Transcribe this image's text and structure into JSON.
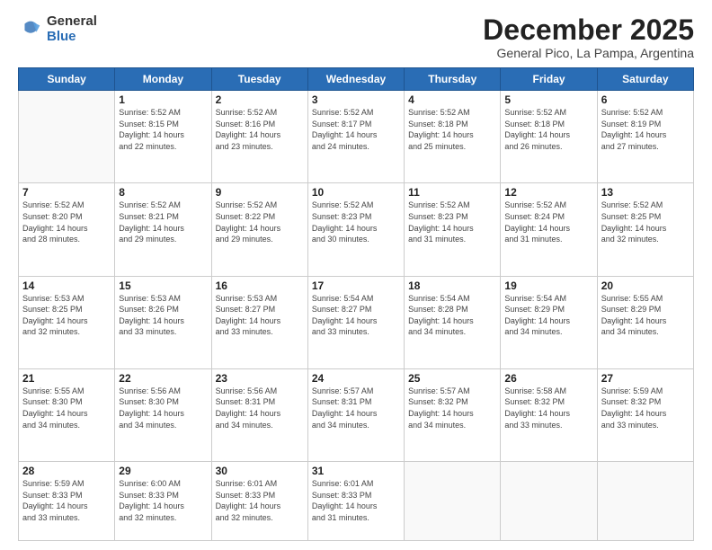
{
  "logo": {
    "general": "General",
    "blue": "Blue"
  },
  "header": {
    "month": "December 2025",
    "location": "General Pico, La Pampa, Argentina"
  },
  "days_of_week": [
    "Sunday",
    "Monday",
    "Tuesday",
    "Wednesday",
    "Thursday",
    "Friday",
    "Saturday"
  ],
  "weeks": [
    [
      {
        "day": "",
        "info": ""
      },
      {
        "day": "1",
        "info": "Sunrise: 5:52 AM\nSunset: 8:15 PM\nDaylight: 14 hours\nand 22 minutes."
      },
      {
        "day": "2",
        "info": "Sunrise: 5:52 AM\nSunset: 8:16 PM\nDaylight: 14 hours\nand 23 minutes."
      },
      {
        "day": "3",
        "info": "Sunrise: 5:52 AM\nSunset: 8:17 PM\nDaylight: 14 hours\nand 24 minutes."
      },
      {
        "day": "4",
        "info": "Sunrise: 5:52 AM\nSunset: 8:18 PM\nDaylight: 14 hours\nand 25 minutes."
      },
      {
        "day": "5",
        "info": "Sunrise: 5:52 AM\nSunset: 8:18 PM\nDaylight: 14 hours\nand 26 minutes."
      },
      {
        "day": "6",
        "info": "Sunrise: 5:52 AM\nSunset: 8:19 PM\nDaylight: 14 hours\nand 27 minutes."
      }
    ],
    [
      {
        "day": "7",
        "info": "Sunrise: 5:52 AM\nSunset: 8:20 PM\nDaylight: 14 hours\nand 28 minutes."
      },
      {
        "day": "8",
        "info": "Sunrise: 5:52 AM\nSunset: 8:21 PM\nDaylight: 14 hours\nand 29 minutes."
      },
      {
        "day": "9",
        "info": "Sunrise: 5:52 AM\nSunset: 8:22 PM\nDaylight: 14 hours\nand 29 minutes."
      },
      {
        "day": "10",
        "info": "Sunrise: 5:52 AM\nSunset: 8:23 PM\nDaylight: 14 hours\nand 30 minutes."
      },
      {
        "day": "11",
        "info": "Sunrise: 5:52 AM\nSunset: 8:23 PM\nDaylight: 14 hours\nand 31 minutes."
      },
      {
        "day": "12",
        "info": "Sunrise: 5:52 AM\nSunset: 8:24 PM\nDaylight: 14 hours\nand 31 minutes."
      },
      {
        "day": "13",
        "info": "Sunrise: 5:52 AM\nSunset: 8:25 PM\nDaylight: 14 hours\nand 32 minutes."
      }
    ],
    [
      {
        "day": "14",
        "info": "Sunrise: 5:53 AM\nSunset: 8:25 PM\nDaylight: 14 hours\nand 32 minutes."
      },
      {
        "day": "15",
        "info": "Sunrise: 5:53 AM\nSunset: 8:26 PM\nDaylight: 14 hours\nand 33 minutes."
      },
      {
        "day": "16",
        "info": "Sunrise: 5:53 AM\nSunset: 8:27 PM\nDaylight: 14 hours\nand 33 minutes."
      },
      {
        "day": "17",
        "info": "Sunrise: 5:54 AM\nSunset: 8:27 PM\nDaylight: 14 hours\nand 33 minutes."
      },
      {
        "day": "18",
        "info": "Sunrise: 5:54 AM\nSunset: 8:28 PM\nDaylight: 14 hours\nand 34 minutes."
      },
      {
        "day": "19",
        "info": "Sunrise: 5:54 AM\nSunset: 8:29 PM\nDaylight: 14 hours\nand 34 minutes."
      },
      {
        "day": "20",
        "info": "Sunrise: 5:55 AM\nSunset: 8:29 PM\nDaylight: 14 hours\nand 34 minutes."
      }
    ],
    [
      {
        "day": "21",
        "info": "Sunrise: 5:55 AM\nSunset: 8:30 PM\nDaylight: 14 hours\nand 34 minutes."
      },
      {
        "day": "22",
        "info": "Sunrise: 5:56 AM\nSunset: 8:30 PM\nDaylight: 14 hours\nand 34 minutes."
      },
      {
        "day": "23",
        "info": "Sunrise: 5:56 AM\nSunset: 8:31 PM\nDaylight: 14 hours\nand 34 minutes."
      },
      {
        "day": "24",
        "info": "Sunrise: 5:57 AM\nSunset: 8:31 PM\nDaylight: 14 hours\nand 34 minutes."
      },
      {
        "day": "25",
        "info": "Sunrise: 5:57 AM\nSunset: 8:32 PM\nDaylight: 14 hours\nand 34 minutes."
      },
      {
        "day": "26",
        "info": "Sunrise: 5:58 AM\nSunset: 8:32 PM\nDaylight: 14 hours\nand 33 minutes."
      },
      {
        "day": "27",
        "info": "Sunrise: 5:59 AM\nSunset: 8:32 PM\nDaylight: 14 hours\nand 33 minutes."
      }
    ],
    [
      {
        "day": "28",
        "info": "Sunrise: 5:59 AM\nSunset: 8:33 PM\nDaylight: 14 hours\nand 33 minutes."
      },
      {
        "day": "29",
        "info": "Sunrise: 6:00 AM\nSunset: 8:33 PM\nDaylight: 14 hours\nand 32 minutes."
      },
      {
        "day": "30",
        "info": "Sunrise: 6:01 AM\nSunset: 8:33 PM\nDaylight: 14 hours\nand 32 minutes."
      },
      {
        "day": "31",
        "info": "Sunrise: 6:01 AM\nSunset: 8:33 PM\nDaylight: 14 hours\nand 31 minutes."
      },
      {
        "day": "",
        "info": ""
      },
      {
        "day": "",
        "info": ""
      },
      {
        "day": "",
        "info": ""
      }
    ]
  ]
}
